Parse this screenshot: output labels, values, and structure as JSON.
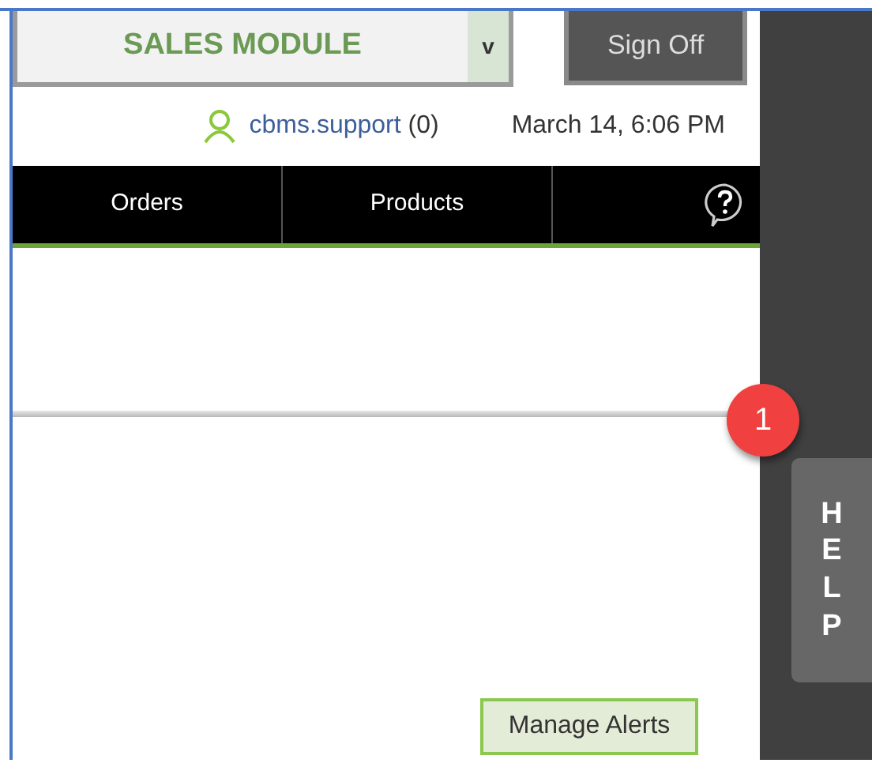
{
  "module_selector": {
    "value": "SALES MODULE",
    "caret": "v"
  },
  "sign_off_button": "Sign Off",
  "user": {
    "name": "cbms.support",
    "count": "(0)"
  },
  "datetime": "March 14, 6:06 PM",
  "nav_tabs": [
    {
      "label": "Orders"
    },
    {
      "label": "Products"
    }
  ],
  "notification_badge": "1",
  "help_tab": "HELP",
  "manage_alerts_button": "Manage Alerts"
}
